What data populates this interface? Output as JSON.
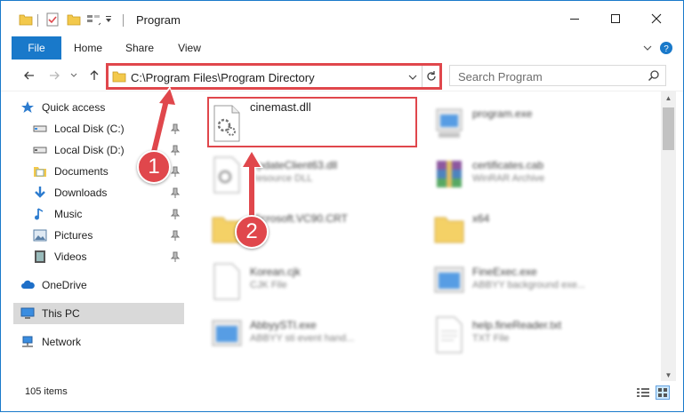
{
  "window": {
    "title": "Program",
    "colors": {
      "accent": "#1979ca",
      "highlight": "#e0474c",
      "selected": "#cce8ff"
    }
  },
  "ribbon": {
    "tabs": [
      {
        "label": "File"
      },
      {
        "label": "Home"
      },
      {
        "label": "Share"
      },
      {
        "label": "View"
      }
    ]
  },
  "nav": {
    "address": "C:\\Program Files\\Program Directory",
    "search_placeholder": "Search Program"
  },
  "sidebar": {
    "items": [
      {
        "label": "Quick access",
        "icon": "star-icon"
      },
      {
        "label": "Local Disk (C:)",
        "icon": "drive-icon"
      },
      {
        "label": "Local Disk (D:)",
        "icon": "drive-icon"
      },
      {
        "label": "Documents",
        "icon": "documents-icon"
      },
      {
        "label": "Downloads",
        "icon": "download-icon"
      },
      {
        "label": "Music",
        "icon": "music-icon"
      },
      {
        "label": "Pictures",
        "icon": "pictures-icon"
      },
      {
        "label": "Videos",
        "icon": "videos-icon"
      },
      {
        "label": "OneDrive",
        "icon": "cloud-icon"
      },
      {
        "label": "This PC",
        "icon": "computer-icon"
      },
      {
        "label": "Network",
        "icon": "network-icon"
      }
    ]
  },
  "files": [
    {
      "name": "cinemast.dll",
      "type": "",
      "icon": "dll-icon"
    },
    {
      "name": "program.exe",
      "type": "",
      "icon": "exe-icon"
    },
    {
      "name": "UpdateClient63.dll",
      "type": "Resource DLL",
      "icon": "dll-icon"
    },
    {
      "name": "certificates.cab",
      "type": "WinRAR Archive",
      "icon": "archive-icon"
    },
    {
      "name": "Microsoft.VC90.CRT",
      "type": "",
      "icon": "folder-icon"
    },
    {
      "name": "x64",
      "type": "",
      "icon": "folder-icon"
    },
    {
      "name": "Korean.cjk",
      "type": "CJK File",
      "icon": "file-icon"
    },
    {
      "name": "FineExec.exe",
      "type": "ABBYY background exe...",
      "icon": "exe-icon"
    },
    {
      "name": "AbbyySTI.exe",
      "type": "ABBYY sti event hand...",
      "icon": "exe-icon"
    },
    {
      "name": "help.fineReader.txt",
      "type": "TXT File",
      "icon": "txt-icon"
    }
  ],
  "status": {
    "count": "105 items"
  },
  "annotations": {
    "step1": "1",
    "step2": "2"
  }
}
